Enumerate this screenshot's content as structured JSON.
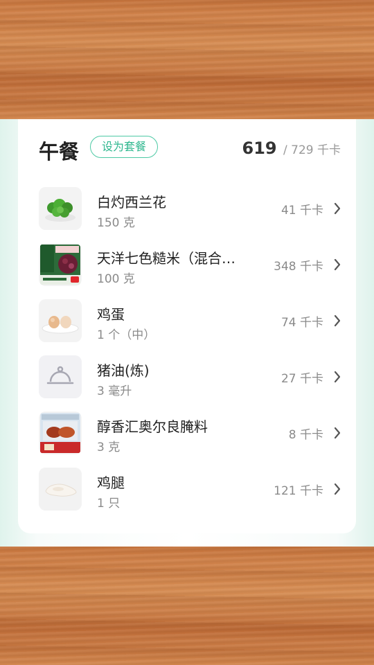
{
  "meal": {
    "title": "午餐",
    "set_meal_label": "设为套餐",
    "calories_eaten": "619",
    "calories_total": "/ 729 千卡"
  },
  "foods": [
    {
      "name": "白灼西兰花",
      "amount": "150 克",
      "calories": "41 千卡",
      "icon": "broccoli-icon"
    },
    {
      "name": "天洋七色糙米（混合…",
      "amount": "100 克",
      "calories": "348 千卡",
      "icon": "rice-package-icon"
    },
    {
      "name": "鸡蛋",
      "amount": "1 个（中）",
      "calories": "74 千卡",
      "icon": "eggs-icon"
    },
    {
      "name": "猪油(炼)",
      "amount": "3 毫升",
      "calories": "27 千卡",
      "icon": "food-cloche-icon"
    },
    {
      "name": "醇香汇奥尔良腌料",
      "amount": "3 克",
      "calories": "8 千卡",
      "icon": "marinade-package-icon"
    },
    {
      "name": "鸡腿",
      "amount": "1 只",
      "calories": "121 千卡",
      "icon": "chicken-leg-icon"
    }
  ],
  "colors": {
    "accent": "#4cc9a4",
    "wood": "#c8743e"
  }
}
